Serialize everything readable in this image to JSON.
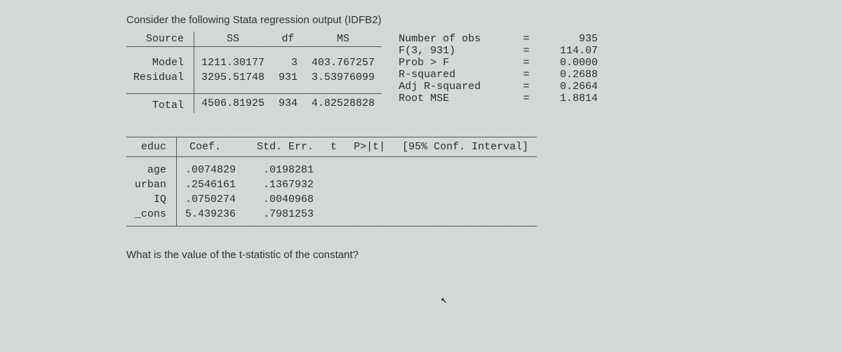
{
  "intro": "Consider the following Stata regression output (IDFB2)",
  "anova": {
    "headers": {
      "source": "Source",
      "ss": "SS",
      "df": "df",
      "ms": "MS"
    },
    "rows": {
      "model": {
        "label": "Model",
        "ss": "1211.30177",
        "df": "3",
        "ms": "403.767257"
      },
      "residual": {
        "label": "Residual",
        "ss": "3295.51748",
        "df": "931",
        "ms": "3.53976099"
      },
      "total": {
        "label": "Total",
        "ss": "4506.81925",
        "df": "934",
        "ms": "4.82528828"
      }
    }
  },
  "fit": {
    "nobs": {
      "label": "Number of obs",
      "eq": "=",
      "val": "935"
    },
    "fstat": {
      "label": "F(3, 931)",
      "eq": "=",
      "val": "114.07"
    },
    "probf": {
      "label": "Prob > F",
      "eq": "=",
      "val": "0.0000"
    },
    "r2": {
      "label": "R-squared",
      "eq": "=",
      "val": "0.2688"
    },
    "adjr2": {
      "label": "Adj R-squared",
      "eq": "=",
      "val": "0.2664"
    },
    "rmse": {
      "label": "Root MSE",
      "eq": "=",
      "val": "1.8814"
    }
  },
  "coef": {
    "depvar": "educ",
    "headers": {
      "coef": "Coef.",
      "se": "Std. Err.",
      "t": "t",
      "p": "P>|t|",
      "ci": "[95% Conf. Interval]"
    },
    "rows": {
      "age": {
        "label": "age",
        "coef": ".0074829",
        "se": ".0198281",
        "t": "",
        "p": "",
        "ci_lo": "",
        "ci_hi": ""
      },
      "urban": {
        "label": "urban",
        "coef": ".2546161",
        "se": ".1367932",
        "t": "",
        "p": "",
        "ci_lo": "",
        "ci_hi": ""
      },
      "iq": {
        "label": "IQ",
        "coef": ".0750274",
        "se": ".0040968",
        "t": "",
        "p": "",
        "ci_lo": "",
        "ci_hi": ""
      },
      "cons": {
        "label": "_cons",
        "coef": "5.439236",
        "se": ".7981253",
        "t": "",
        "p": "",
        "ci_lo": "",
        "ci_hi": ""
      }
    }
  },
  "question": "What is the value of the t-statistic of the constant?"
}
